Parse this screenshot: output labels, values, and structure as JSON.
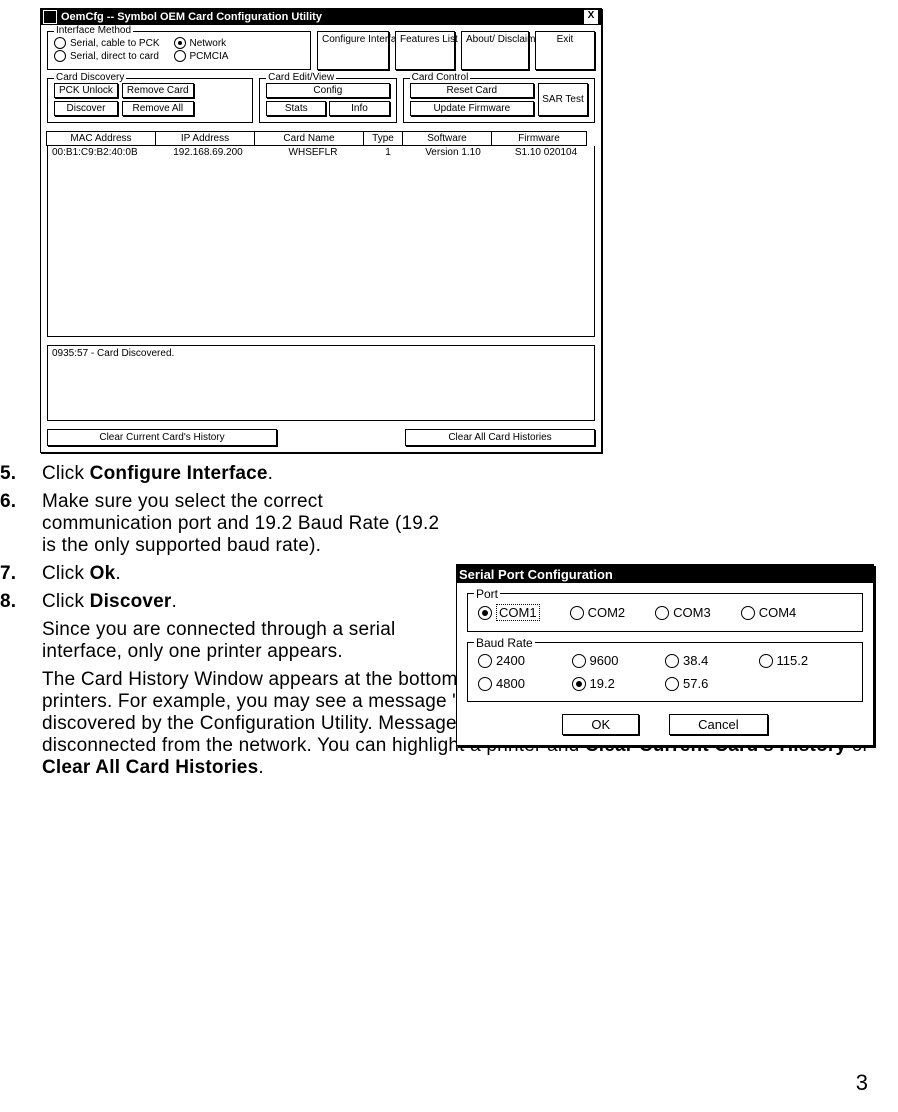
{
  "page_number": "3",
  "oemcfg": {
    "title": "OemCfg -- Symbol OEM Card Configuration Utility",
    "close": "X",
    "interface_method": {
      "legend": "Interface Method",
      "opt_serial_pck": "Serial, cable to PCK",
      "opt_serial_card": "Serial, direct to card",
      "opt_network": "Network",
      "opt_pcmcia": "PCMCIA"
    },
    "btns": {
      "configure_interface": "Configure Interface",
      "features_list": "Features List",
      "about_disclaimer": "About/ Disclaimer",
      "exit": "Exit"
    },
    "card_discovery": {
      "legend": "Card Discovery",
      "pck_unlock": "PCK Unlock",
      "discover": "Discover",
      "remove_card": "Remove Card",
      "remove_all": "Remove All"
    },
    "card_edit": {
      "legend": "Card Edit/View",
      "config": "Config",
      "stats": "Stats",
      "info": "Info"
    },
    "card_control": {
      "legend": "Card Control",
      "reset_card": "Reset Card",
      "update_firmware": "Update Firmware",
      "sar_test": "SAR Test"
    },
    "table": {
      "headers": {
        "mac": "MAC Address",
        "ip": "IP Address",
        "name": "Card Name",
        "type": "Type",
        "software": "Software",
        "firmware": "Firmware"
      },
      "row": {
        "mac": "00:B1:C9:B2:40:0B",
        "ip": "192.168.69.200",
        "name": "WHSEFLR",
        "type": "1",
        "software": "Version 1.10",
        "firmware": "S1.10 020104"
      }
    },
    "history_entry": "0935:57 - Card Discovered.",
    "clear_current": "Clear Current Card's History",
    "clear_all": "Clear All Card Histories"
  },
  "serial": {
    "title": "Serial Port Configuration",
    "port_legend": "Port",
    "com1": "COM1",
    "com2": "COM2",
    "com3": "COM3",
    "com4": "COM4",
    "baud_legend": "Baud Rate",
    "b2400": "2400",
    "b9600": "9600",
    "b384": "38.4",
    "b1152": "115.2",
    "b4800": "4800",
    "b192": "19.2",
    "b576": "57.6",
    "ok": "OK",
    "cancel": "Cancel"
  },
  "steps": {
    "s5": {
      "num": "5.",
      "pre": "Click ",
      "bold": "Configure Interface",
      "post": "."
    },
    "s6": {
      "num": "6.",
      "text": "Make sure you select the correct communication port and 19.2 Baud Rate (19.2 is the only supported baud rate)."
    },
    "s7": {
      "num": "7.",
      "pre": "Click ",
      "bold": "Ok",
      "post": "."
    },
    "s8": {
      "num": "8.",
      "pre": "Click ",
      "bold": "Discover",
      "post": "."
    },
    "s8_para1": "Since you are connected through a serial interface, only one printer appears.",
    "s8_para2_pre": "The Card History Window appears at the bottom of the screen to give a status of the connected printers.  For example, you may see a message \"Card Discovered\" when an IP printer is discovered by the Configuration Utility.  Messages also appear when printers are turned off or disconnected from the network.  You can highlight a printer and ",
    "s8_para2_b1": "Clear Current Card's History",
    "s8_para2_mid": " or ",
    "s8_para2_b2": "Clear All Card Histories",
    "s8_para2_post": "."
  }
}
